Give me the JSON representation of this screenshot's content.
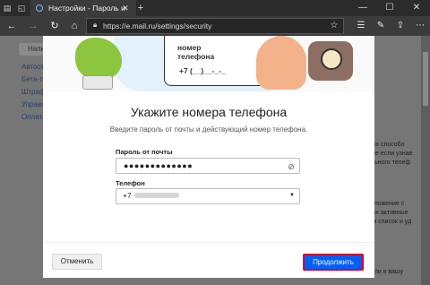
{
  "browser": {
    "tab_title": "Настройки - Пароль и",
    "tab_close": "✕",
    "new_tab": "+",
    "url": "https://e.mail.ru/settings/security",
    "window_controls": {
      "minimize": "—",
      "maximize": "☐",
      "close": "✕"
    },
    "icons": {
      "tab_list": "tab-list-icon",
      "back": "back-arrow-icon",
      "forward": "forward-arrow-icon",
      "refresh": "refresh-icon",
      "favorite": "star-icon",
      "favorites_bar": "favorites-bar-icon",
      "pen": "pen-icon",
      "share": "share-icon",
      "more": "more-icon"
    }
  },
  "background_page": {
    "compose_button": "Напи",
    "sidebar_links": [
      "Автоот",
      "Бета-те",
      "Штраф",
      "Управле",
      "Оплата"
    ],
    "right_text": [
      "жных способо",
      "ужже если узнае",
      "бильного телеф",
      "приложение с",
      "аших активные",
      "шем список и уд",
      "одили в вашу"
    ]
  },
  "modal": {
    "illustration": {
      "phone_line1": "номер",
      "phone_line2": "телефона",
      "phone_number": "+7 (__)__-_-_"
    },
    "title": "Укажите номера телефона",
    "subtitle": "Введите пароль от почты и действующий номер телефона.",
    "password": {
      "label": "Пароль от почты",
      "value": "●●●●●●●●●●●●●",
      "icon": "eye-hidden-icon"
    },
    "phone": {
      "label": "Телефон",
      "country_code": "+7",
      "icon": "chevron-down-icon"
    },
    "cancel_button": "Отменить",
    "continue_button": "Продолжить"
  }
}
